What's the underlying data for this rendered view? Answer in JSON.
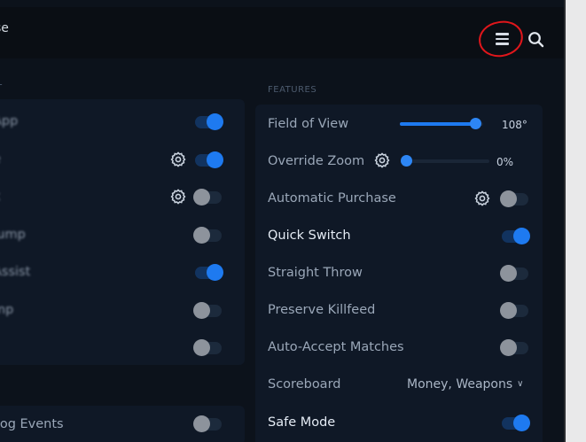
{
  "header": {
    "title": "se"
  },
  "left_panel": {
    "section_label": "T",
    "rows": [
      {
        "label": "App",
        "enabled": true,
        "has_gear": false
      },
      {
        "label": "e",
        "enabled": true,
        "has_gear": true
      },
      {
        "label": "k",
        "enabled": false,
        "has_gear": true
      },
      {
        "label": "Jump",
        "enabled": false,
        "has_gear": false
      },
      {
        "label": "Assist",
        "enabled": true,
        "has_gear": false
      },
      {
        "label": "mp",
        "enabled": false,
        "has_gear": false
      },
      {
        "label": "",
        "enabled": false,
        "has_gear": false
      }
    ],
    "bottom_row": {
      "label": "Log Events",
      "enabled": false
    }
  },
  "features": {
    "section_label": "FEATURES",
    "field_of_view": {
      "label": "Field of View",
      "value": 108,
      "value_text": "108°",
      "min": 0,
      "max": 120
    },
    "override_zoom": {
      "label": "Override Zoom",
      "value": 0,
      "value_text": "0%"
    },
    "automatic_purchase": {
      "label": "Automatic Purchase",
      "enabled": false
    },
    "quick_switch": {
      "label": "Quick Switch",
      "enabled": true
    },
    "straight_throw": {
      "label": "Straight Throw",
      "enabled": false
    },
    "preserve_killfeed": {
      "label": "Preserve Killfeed",
      "enabled": false
    },
    "auto_accept": {
      "label": "Auto-Accept Matches",
      "enabled": false
    },
    "scoreboard": {
      "label": "Scoreboard",
      "selected": "Money, Weapons"
    },
    "safe_mode": {
      "label": "Safe Mode",
      "enabled": true
    }
  },
  "colors": {
    "accent": "#1e7af0",
    "annotation": "#e0161b"
  }
}
